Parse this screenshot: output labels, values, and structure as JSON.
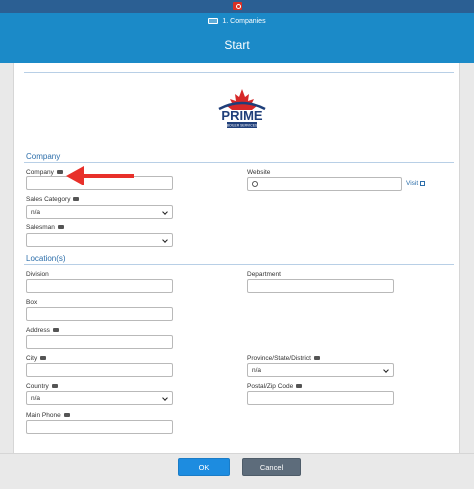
{
  "header": {
    "breadcrumb": "1. Companies",
    "title": "Start"
  },
  "logo": {
    "brand": "PRIME",
    "tagline": "BOILER SERVICES"
  },
  "sections": {
    "company": "Company",
    "locations": "Location(s)"
  },
  "company": {
    "company_label": "Company",
    "company_value": "",
    "website_label": "Website",
    "website_value": "",
    "visit_label": "Visit",
    "sales_category_label": "Sales Category",
    "sales_category_value": "n/a",
    "salesman_label": "Salesman",
    "salesman_value": ""
  },
  "location": {
    "division_label": "Division",
    "division_value": "",
    "department_label": "Department",
    "department_value": "",
    "box_label": "Box",
    "box_value": "",
    "address_label": "Address",
    "address_value": "",
    "city_label": "City",
    "city_value": "",
    "province_label": "Province/State/District",
    "province_value": "n/a",
    "country_label": "Country",
    "country_value": "n/a",
    "postal_label": "Postal/Zip Code",
    "postal_value": "",
    "phone_label": "Main Phone",
    "phone_value": ""
  },
  "footer": {
    "ok_label": "OK",
    "cancel_label": "Cancel"
  },
  "colors": {
    "header": "#1b8ac8",
    "topbar": "#2b5f93",
    "ok_button": "#1d8ce0",
    "cancel_button": "#5d6c7b",
    "arrow": "#e8302a"
  }
}
